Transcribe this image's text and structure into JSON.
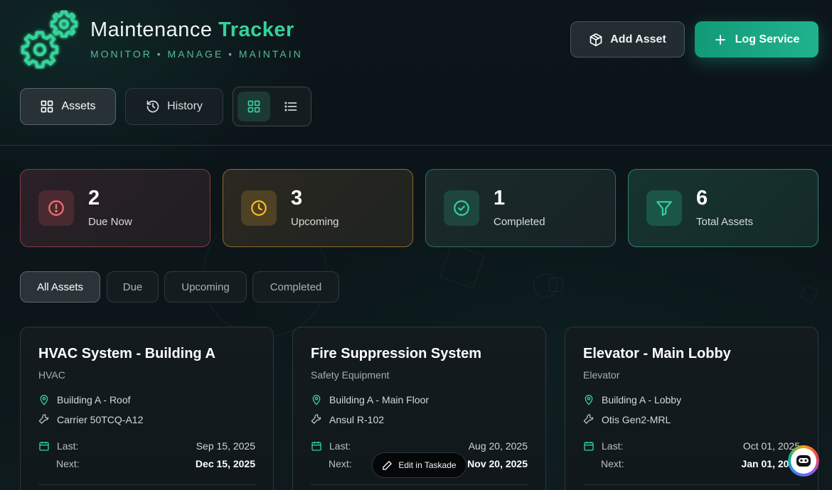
{
  "header": {
    "title_main": "Maintenance",
    "title_accent": "Tracker",
    "subtitle": "MONITOR • MANAGE • MAINTAIN",
    "add_asset_label": "Add Asset",
    "log_service_label": "Log Service"
  },
  "nav": {
    "assets_label": "Assets",
    "history_label": "History",
    "view_mode": "grid"
  },
  "stats": [
    {
      "value": "2",
      "label": "Due Now",
      "icon": "alert-circle-icon",
      "color": "#f87171"
    },
    {
      "value": "3",
      "label": "Upcoming",
      "icon": "clock-icon",
      "color": "#fbbf24"
    },
    {
      "value": "1",
      "label": "Completed",
      "icon": "check-circle-icon",
      "color": "#34d399"
    },
    {
      "value": "6",
      "label": "Total Assets",
      "icon": "filter-icon",
      "color": "#34d399"
    }
  ],
  "filters": [
    "All Assets",
    "Due",
    "Upcoming",
    "Completed"
  ],
  "active_filter": "All Assets",
  "assets": [
    {
      "name": "HVAC System - Building A",
      "category": "HVAC",
      "location": "Building A - Roof",
      "model": "Carrier 50TCQ-A12",
      "last_label": "Last:",
      "last": "Sep 15, 2025",
      "next_label": "Next:",
      "next": "Dec 15, 2025"
    },
    {
      "name": "Fire Suppression System",
      "category": "Safety Equipment",
      "location": "Building A - Main Floor",
      "model": "Ansul R-102",
      "last_label": "Last:",
      "last": "Aug 20, 2025",
      "next_label": "Next:",
      "next": "Nov 20, 2025"
    },
    {
      "name": "Elevator - Main Lobby",
      "category": "Elevator",
      "location": "Building A - Lobby",
      "model": "Otis Gen2-MRL",
      "last_label": "Last:",
      "last": "Oct 01, 2025",
      "next_label": "Next:",
      "next": "Jan 01, 2026"
    }
  ],
  "overlay": {
    "edit_label": "Edit in Taskade"
  },
  "colors": {
    "accent": "#34d399",
    "accent_button": "#1fb38d",
    "background": "#0b1318"
  }
}
